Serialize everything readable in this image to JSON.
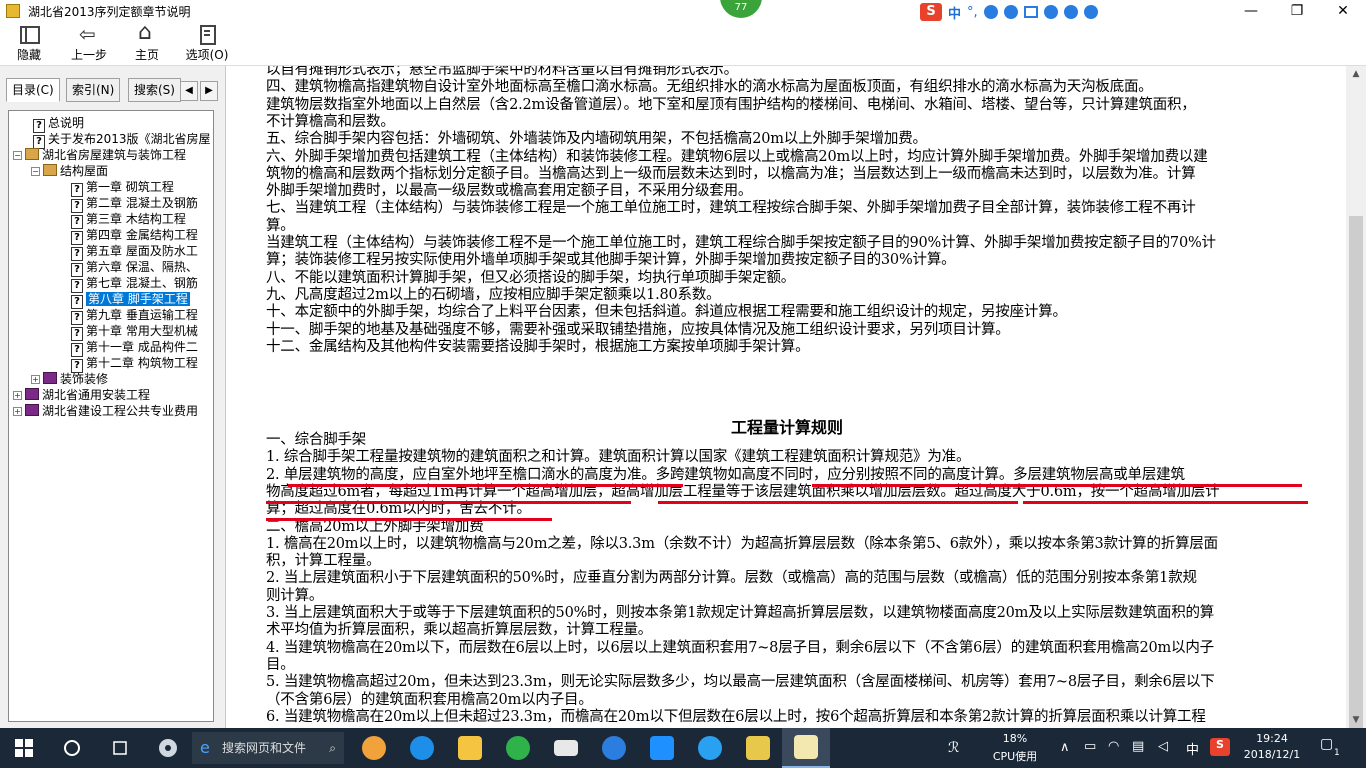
{
  "window": {
    "title": "湖北省2013序列定额章节说明",
    "badge": "77",
    "ime": {
      "logo": "S",
      "lang": "中"
    },
    "controls": {
      "minimize": "—",
      "maximize": "❐",
      "close": "✕"
    }
  },
  "toolbar": {
    "buttons": [
      {
        "label": "隐藏",
        "icon": "hide-pane-icon"
      },
      {
        "label": "上一步",
        "icon": "back-arrow-icon"
      },
      {
        "label": "主页",
        "icon": "home-icon"
      },
      {
        "label": "选项(O)",
        "icon": "options-icon"
      }
    ]
  },
  "nav": {
    "tabs": [
      "目录(C)",
      "索引(N)",
      "搜索(S)"
    ],
    "tree": [
      {
        "label": "总说明",
        "kind": "page",
        "level": 1
      },
      {
        "label": "关于发布2013版《湖北省房屋",
        "kind": "page",
        "level": 1
      },
      {
        "label": "湖北省房屋建筑与装饰工程",
        "kind": "book-open",
        "level": 0,
        "expander": "−"
      },
      {
        "label": "结构屋面",
        "kind": "book-open",
        "level": 1,
        "expander": "−"
      },
      {
        "label": "第一章 砌筑工程",
        "kind": "page",
        "level": 2
      },
      {
        "label": "第二章 混凝土及钢筋",
        "kind": "page",
        "level": 2
      },
      {
        "label": "第三章 木结构工程",
        "kind": "page",
        "level": 2
      },
      {
        "label": "第四章 金属结构工程",
        "kind": "page",
        "level": 2
      },
      {
        "label": "第五章 屋面及防水工",
        "kind": "page",
        "level": 2
      },
      {
        "label": "第六章 保温、隔热、",
        "kind": "page",
        "level": 2
      },
      {
        "label": "第七章 混凝土、钢筋",
        "kind": "page",
        "level": 2
      },
      {
        "label": "第八章 脚手架工程",
        "kind": "page",
        "level": 2,
        "selected": true
      },
      {
        "label": "第九章 垂直运输工程",
        "kind": "page",
        "level": 2
      },
      {
        "label": "第十章 常用大型机械",
        "kind": "page",
        "level": 2
      },
      {
        "label": "第十一章 成品构件二",
        "kind": "page",
        "level": 2
      },
      {
        "label": "第十二章 构筑物工程",
        "kind": "page",
        "level": 2
      },
      {
        "label": "装饰装修",
        "kind": "book",
        "level": 1,
        "expander": "+"
      },
      {
        "label": "湖北省通用安装工程",
        "kind": "book",
        "level": 0,
        "expander": "+"
      },
      {
        "label": "湖北省建设工程公共专业费用",
        "kind": "book",
        "level": 0,
        "expander": "+"
      }
    ]
  },
  "content": {
    "lines_top": [
      "以自有摊销形式表示；悬空吊篮脚手架中的材料含量以自有摊销形式表示。",
      "四、建筑物檐高指建筑物自设计室外地面标高至檐口滴水标高。无组织排水的滴水标高为屋面板顶面，有组织排水的滴水标高为天沟板底面。",
      "建筑物层数指室外地面以上自然层（含2.2m设备管道层）。地下室和屋顶有围护结构的楼梯间、电梯间、水箱间、塔楼、望台等，只计算建筑面积，",
      "不计算檐高和层数。",
      "五、综合脚手架内容包括：外墙砌筑、外墙装饰及内墙砌筑用架，不包括檐高20m以上外脚手架增加费。",
      "六、外脚手架增加费包括建筑工程（主体结构）和装饰装修工程。建筑物6层以上或檐高20m以上时，均应计算外脚手架增加费。外脚手架增加费以建",
      "筑物的檐高和层数两个指标划分定额子目。当檐高达到上一级而层数未达到时，以檐高为准；当层数达到上一级而檐高未达到时，以层数为准。计算",
      "外脚手架增加费时，以最高一级层数或檐高套用定额子目，不采用分级套用。",
      "七、当建筑工程（主体结构）与装饰装修工程是一个施工单位施工时，建筑工程按综合脚手架、外脚手架增加费子目全部计算，装饰装修工程不再计",
      "算。",
      "当建筑工程（主体结构）与装饰装修工程不是一个施工单位施工时，建筑工程综合脚手架按定额子目的90%计算、外脚手架增加费按定额子目的70%计",
      "算；装饰装修工程另按实际使用外墙单项脚手架或其他脚手架计算，外脚手架增加费按定额子目的30%计算。",
      "八、不能以建筑面积计算脚手架，但又必须搭设的脚手架，均执行单项脚手架定额。",
      "九、凡高度超过2m以上的石砌墙，应按相应脚手架定额乘以1.80系数。",
      "十、本定额中的外脚手架，均综合了上料平台因素，但未包括斜道。斜道应根据工程需要和施工组织设计的规定，另按座计算。",
      "十一、脚手架的地基及基础强度不够，需要补强或采取铺垫措施，应按具体情况及施工组织设计要求，另列项目计算。",
      "十二、金属结构及其他构件安装需要搭设脚手架时，根据施工方案按单项脚手架计算。"
    ],
    "section_title": "工程量计算规则",
    "lines_rules": [
      "一、综合脚手架",
      "1. 综合脚手架工程量按建筑物的建筑面积之和计算。建筑面积计算以国家《建筑工程建筑面积计算规范》为准。",
      "2. 单层建筑物的高度，应自室外地坪至檐口滴水的高度为准。多跨建筑物如高度不同时，应分别按照不同的高度计算。多层建筑物层高或单层建筑",
      "物高度超过6m者，每超过1m再计算一个超高增加层，超高增加层工程量等于该层建筑面积乘以增加层层数。超过高度大于0.6m，按一个超高增加层计",
      "算；超过高度在0.6m以内时，舍去不计。",
      "二、檐高20m以上外脚手架增加费",
      "1. 檐高在20m以上时，以建筑物檐高与20m之差，除以3.3m（余数不计）为超高折算层层数（除本条第5、6款外），乘以按本条第3款计算的折算层面",
      "积，计算工程量。",
      "2. 当上层建筑面积小于下层建筑面积的50%时，应垂直分割为两部分计算。层数（或檐高）高的范围与层数（或檐高）低的范围分别按本条第1款规",
      "则计算。",
      "3. 当上层建筑面积大于或等于下层建筑面积的50%时，则按本条第1款规定计算超高折算层层数，以建筑物楼面高度20m及以上实际层数建筑面积的算",
      "术平均值为折算层面积，乘以超高折算层层数，计算工程量。",
      "4. 当建筑物檐高在20m以下，而层数在6层以上时，以6层以上建筑面积套用7~8层子目，剩余6层以下（不含第6层）的建筑面积套用檐高20m以内子",
      "目。",
      "5. 当建筑物檐高超过20m，但未达到23.3m，则无论实际层数多少，均以最高一层建筑面积（含屋面楼梯间、机房等）套用7~8层子目，剩余6层以下",
      "（不含第6层）的建筑面积套用檐高20m以内子目。",
      "6. 当建筑物檐高在20m以上但未超过23.3m，而檐高在20m以下但层数在6层以上时，按6个超高折算层和本条第2款计算的折算层面积乘以计算工程"
    ]
  },
  "taskbar": {
    "search_placeholder": "搜索网页和文件",
    "cpu_percent": "18%",
    "cpu_label": "CPU使用",
    "tray_lang": "中",
    "time": "19:24",
    "date": "2018/12/1",
    "notification_count": "1"
  }
}
